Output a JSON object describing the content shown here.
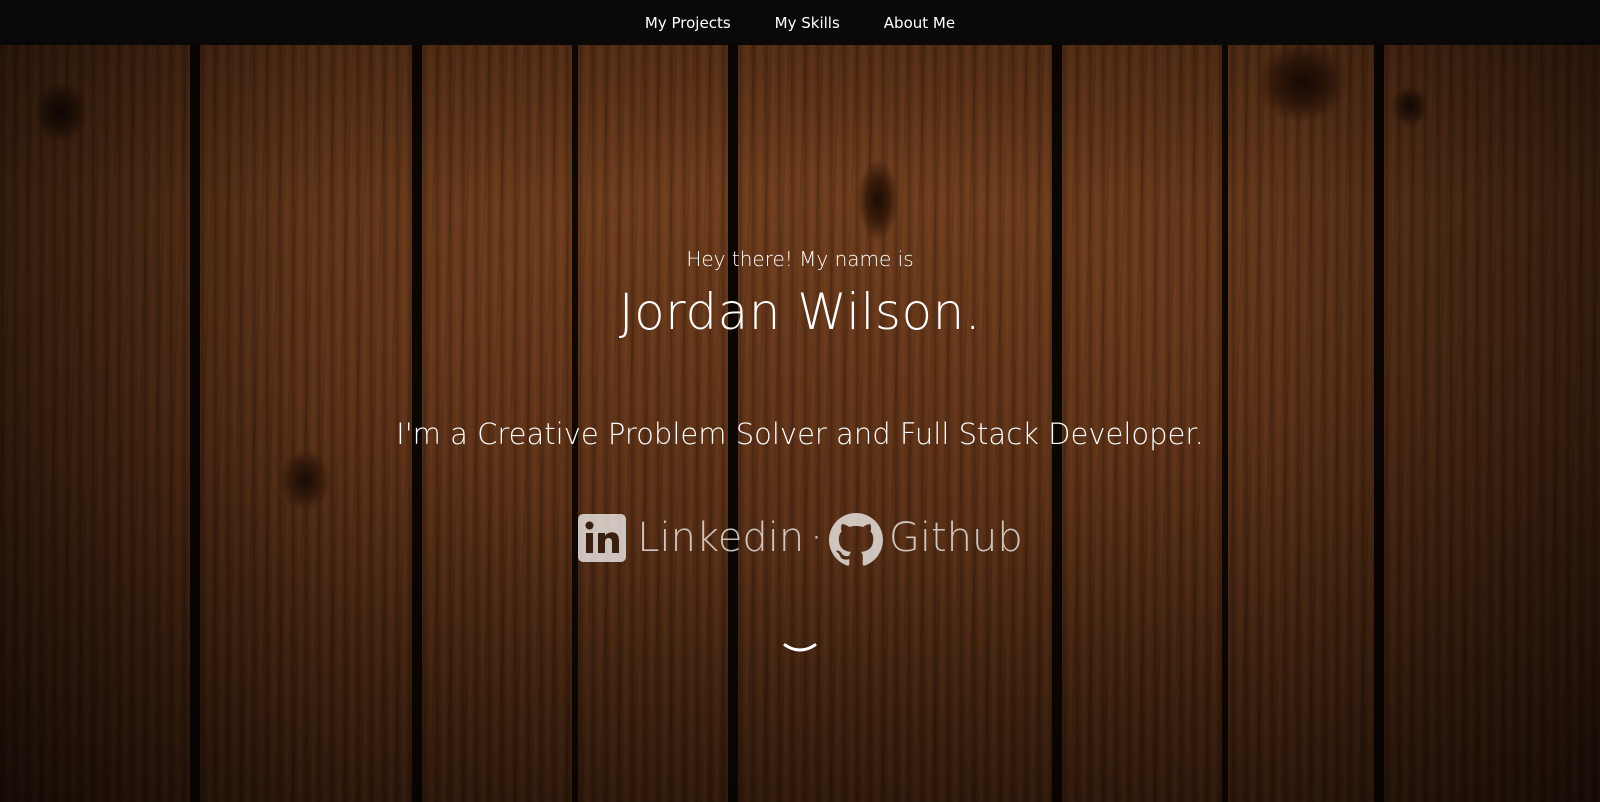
{
  "nav": {
    "items": [
      {
        "label": "My Projects"
      },
      {
        "label": "My Skills"
      },
      {
        "label": "About Me"
      }
    ]
  },
  "hero": {
    "greeting": "Hey there! My name is",
    "name": "Jordan Wilson.",
    "tagline": "I'm a Creative Problem Solver and Full Stack Developer.",
    "socials": {
      "linkedin_label": "Linkedin",
      "separator": "·",
      "github_label": "Github"
    }
  },
  "icons": {
    "linkedin": "linkedin-icon",
    "github": "github-icon",
    "scroll": "chevron-down-icon"
  },
  "colors": {
    "nav_bg": "#080808",
    "text": "#ffffff",
    "wood": "#5a2f15"
  }
}
